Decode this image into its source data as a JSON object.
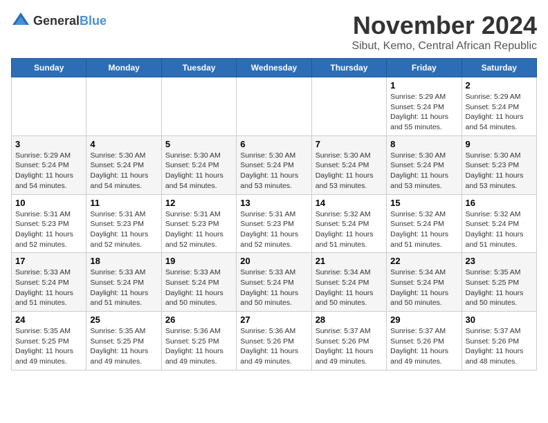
{
  "header": {
    "logo_general": "General",
    "logo_blue": "Blue",
    "title": "November 2024",
    "subtitle": "Sibut, Kemo, Central African Republic"
  },
  "days_of_week": [
    "Sunday",
    "Monday",
    "Tuesday",
    "Wednesday",
    "Thursday",
    "Friday",
    "Saturday"
  ],
  "weeks": [
    {
      "cells": [
        {
          "day": null,
          "empty": true
        },
        {
          "day": null,
          "empty": true
        },
        {
          "day": null,
          "empty": true
        },
        {
          "day": null,
          "empty": true
        },
        {
          "day": null,
          "empty": true
        },
        {
          "day": "1",
          "sunrise": "Sunrise: 5:29 AM",
          "sunset": "Sunset: 5:24 PM",
          "daylight": "Daylight: 11 hours and 55 minutes."
        },
        {
          "day": "2",
          "sunrise": "Sunrise: 5:29 AM",
          "sunset": "Sunset: 5:24 PM",
          "daylight": "Daylight: 11 hours and 54 minutes."
        }
      ]
    },
    {
      "cells": [
        {
          "day": "3",
          "sunrise": "Sunrise: 5:29 AM",
          "sunset": "Sunset: 5:24 PM",
          "daylight": "Daylight: 11 hours and 54 minutes."
        },
        {
          "day": "4",
          "sunrise": "Sunrise: 5:30 AM",
          "sunset": "Sunset: 5:24 PM",
          "daylight": "Daylight: 11 hours and 54 minutes."
        },
        {
          "day": "5",
          "sunrise": "Sunrise: 5:30 AM",
          "sunset": "Sunset: 5:24 PM",
          "daylight": "Daylight: 11 hours and 54 minutes."
        },
        {
          "day": "6",
          "sunrise": "Sunrise: 5:30 AM",
          "sunset": "Sunset: 5:24 PM",
          "daylight": "Daylight: 11 hours and 53 minutes."
        },
        {
          "day": "7",
          "sunrise": "Sunrise: 5:30 AM",
          "sunset": "Sunset: 5:24 PM",
          "daylight": "Daylight: 11 hours and 53 minutes."
        },
        {
          "day": "8",
          "sunrise": "Sunrise: 5:30 AM",
          "sunset": "Sunset: 5:24 PM",
          "daylight": "Daylight: 11 hours and 53 minutes."
        },
        {
          "day": "9",
          "sunrise": "Sunrise: 5:30 AM",
          "sunset": "Sunset: 5:23 PM",
          "daylight": "Daylight: 11 hours and 53 minutes."
        }
      ]
    },
    {
      "cells": [
        {
          "day": "10",
          "sunrise": "Sunrise: 5:31 AM",
          "sunset": "Sunset: 5:23 PM",
          "daylight": "Daylight: 11 hours and 52 minutes."
        },
        {
          "day": "11",
          "sunrise": "Sunrise: 5:31 AM",
          "sunset": "Sunset: 5:23 PM",
          "daylight": "Daylight: 11 hours and 52 minutes."
        },
        {
          "day": "12",
          "sunrise": "Sunrise: 5:31 AM",
          "sunset": "Sunset: 5:23 PM",
          "daylight": "Daylight: 11 hours and 52 minutes."
        },
        {
          "day": "13",
          "sunrise": "Sunrise: 5:31 AM",
          "sunset": "Sunset: 5:23 PM",
          "daylight": "Daylight: 11 hours and 52 minutes."
        },
        {
          "day": "14",
          "sunrise": "Sunrise: 5:32 AM",
          "sunset": "Sunset: 5:24 PM",
          "daylight": "Daylight: 11 hours and 51 minutes."
        },
        {
          "day": "15",
          "sunrise": "Sunrise: 5:32 AM",
          "sunset": "Sunset: 5:24 PM",
          "daylight": "Daylight: 11 hours and 51 minutes."
        },
        {
          "day": "16",
          "sunrise": "Sunrise: 5:32 AM",
          "sunset": "Sunset: 5:24 PM",
          "daylight": "Daylight: 11 hours and 51 minutes."
        }
      ]
    },
    {
      "cells": [
        {
          "day": "17",
          "sunrise": "Sunrise: 5:33 AM",
          "sunset": "Sunset: 5:24 PM",
          "daylight": "Daylight: 11 hours and 51 minutes."
        },
        {
          "day": "18",
          "sunrise": "Sunrise: 5:33 AM",
          "sunset": "Sunset: 5:24 PM",
          "daylight": "Daylight: 11 hours and 51 minutes."
        },
        {
          "day": "19",
          "sunrise": "Sunrise: 5:33 AM",
          "sunset": "Sunset: 5:24 PM",
          "daylight": "Daylight: 11 hours and 50 minutes."
        },
        {
          "day": "20",
          "sunrise": "Sunrise: 5:33 AM",
          "sunset": "Sunset: 5:24 PM",
          "daylight": "Daylight: 11 hours and 50 minutes."
        },
        {
          "day": "21",
          "sunrise": "Sunrise: 5:34 AM",
          "sunset": "Sunset: 5:24 PM",
          "daylight": "Daylight: 11 hours and 50 minutes."
        },
        {
          "day": "22",
          "sunrise": "Sunrise: 5:34 AM",
          "sunset": "Sunset: 5:24 PM",
          "daylight": "Daylight: 11 hours and 50 minutes."
        },
        {
          "day": "23",
          "sunrise": "Sunrise: 5:35 AM",
          "sunset": "Sunset: 5:25 PM",
          "daylight": "Daylight: 11 hours and 50 minutes."
        }
      ]
    },
    {
      "cells": [
        {
          "day": "24",
          "sunrise": "Sunrise: 5:35 AM",
          "sunset": "Sunset: 5:25 PM",
          "daylight": "Daylight: 11 hours and 49 minutes."
        },
        {
          "day": "25",
          "sunrise": "Sunrise: 5:35 AM",
          "sunset": "Sunset: 5:25 PM",
          "daylight": "Daylight: 11 hours and 49 minutes."
        },
        {
          "day": "26",
          "sunrise": "Sunrise: 5:36 AM",
          "sunset": "Sunset: 5:25 PM",
          "daylight": "Daylight: 11 hours and 49 minutes."
        },
        {
          "day": "27",
          "sunrise": "Sunrise: 5:36 AM",
          "sunset": "Sunset: 5:26 PM",
          "daylight": "Daylight: 11 hours and 49 minutes."
        },
        {
          "day": "28",
          "sunrise": "Sunrise: 5:37 AM",
          "sunset": "Sunset: 5:26 PM",
          "daylight": "Daylight: 11 hours and 49 minutes."
        },
        {
          "day": "29",
          "sunrise": "Sunrise: 5:37 AM",
          "sunset": "Sunset: 5:26 PM",
          "daylight": "Daylight: 11 hours and 49 minutes."
        },
        {
          "day": "30",
          "sunrise": "Sunrise: 5:37 AM",
          "sunset": "Sunset: 5:26 PM",
          "daylight": "Daylight: 11 hours and 48 minutes."
        }
      ]
    }
  ]
}
